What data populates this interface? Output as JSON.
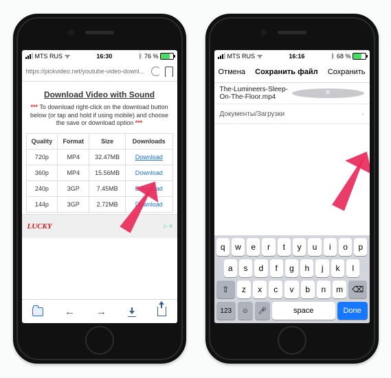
{
  "left": {
    "status": {
      "carrier": "MTS RUS",
      "wifi": "▴",
      "time": "16:30",
      "bt": "฿",
      "pct": "76 %"
    },
    "url": "https://pickvideo.net/youtube-video-downl...",
    "title": "Download Video with Sound",
    "note_prefix": "***",
    "note_text": " To download right-click on the download button below (or tap and hold if using mobile) and choose the save or download option ",
    "note_suffix": "***",
    "headers": [
      "Quality",
      "Format",
      "Size",
      "Downloads"
    ],
    "rows": [
      {
        "q": "720p",
        "f": "MP4",
        "s": "32.47MB",
        "d": "Download"
      },
      {
        "q": "360p",
        "f": "MP4",
        "s": "15.56MB",
        "d": "Download"
      },
      {
        "q": "240p",
        "f": "3GP",
        "s": "7.45MB",
        "d": "Download"
      },
      {
        "q": "144p",
        "f": "3GP",
        "s": "2.72MB",
        "d": "Download"
      }
    ],
    "ad": "LUCKY"
  },
  "right": {
    "status": {
      "carrier": "MTS RUS",
      "time": "16:16",
      "pct": "68 %"
    },
    "nav": {
      "cancel": "Отмена",
      "title": "Сохранить файл",
      "save": "Сохранить"
    },
    "filename": "The-Lumineers-Sleep-On-The-Floor.mp4",
    "location": "Документы/Загрузки",
    "kb": {
      "r1": [
        "q",
        "w",
        "e",
        "r",
        "t",
        "y",
        "u",
        "i",
        "o",
        "p"
      ],
      "r2": [
        "a",
        "s",
        "d",
        "f",
        "g",
        "h",
        "j",
        "k",
        "l"
      ],
      "r3": [
        "z",
        "x",
        "c",
        "v",
        "b",
        "n",
        "m"
      ],
      "n123": "123",
      "space": "space",
      "done": "Done"
    }
  }
}
